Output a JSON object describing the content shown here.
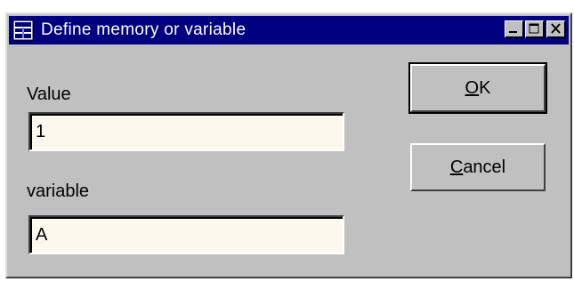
{
  "window": {
    "title": "Define memory or variable",
    "icon": "calculator-app-icon"
  },
  "controls": {
    "minimize": "minimize-icon",
    "maximize": "maximize-icon",
    "close": "close-icon"
  },
  "form": {
    "value_label": "Value",
    "value_field": "1",
    "variable_label": "variable",
    "variable_field": "A"
  },
  "buttons": {
    "ok_accel": "O",
    "ok_rest": "K",
    "cancel_accel": "C",
    "cancel_rest": "ancel"
  },
  "colors": {
    "titlebar": "#000080",
    "window": "#c0c0c0",
    "field_bg": "#fdf8ee"
  }
}
